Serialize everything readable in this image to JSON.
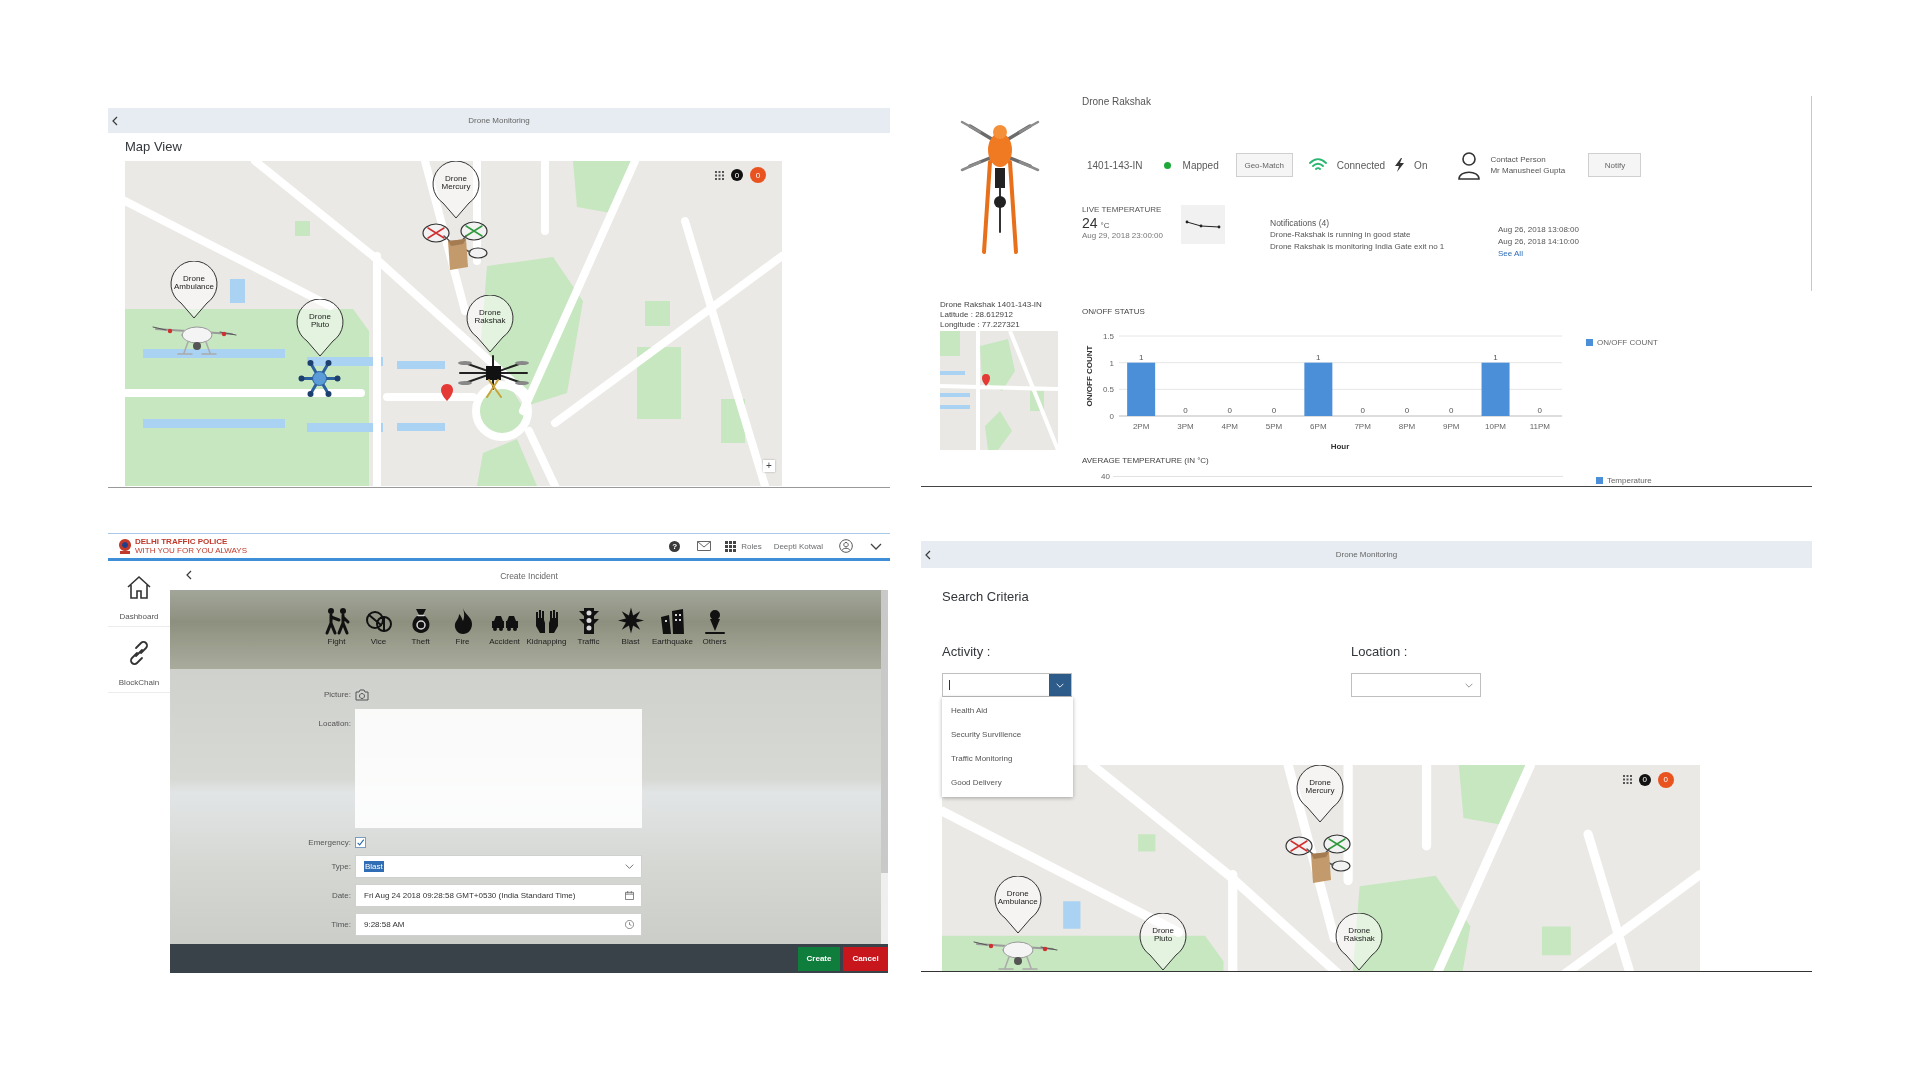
{
  "map_view": {
    "header": {
      "title": "Drone Monitoring"
    },
    "heading": "Map View",
    "map": {
      "markers": [
        {
          "label": "Drone Mercury",
          "kind": "cargo"
        },
        {
          "label": "Drone Ambulance",
          "kind": "medical"
        },
        {
          "label": "Drone Pluto",
          "kind": "hexacopter"
        },
        {
          "label": "Drone Rakshak",
          "kind": "octocopter"
        }
      ],
      "counters": [
        {
          "text": "0",
          "color": "#111111"
        },
        {
          "text": "0",
          "color": "#e8531f"
        }
      ],
      "zoom_button": "+"
    }
  },
  "drone_detail": {
    "title": "Drone Rakshak",
    "drone_id": "1401-143-IN",
    "mapping_status": "Mapped",
    "geo_match_button": "Geo-Match",
    "connection_status": "Connected",
    "power_status": "On",
    "contact": {
      "label": "Contact Person",
      "name": "Mr Manusheel Gupta"
    },
    "notify_button": "Notify",
    "live_temperature": {
      "label": "LIVE TEMPERATURE",
      "value": "24",
      "unit": "°C",
      "timestamp": "Aug 29, 2018 23:00:00"
    },
    "notifications": {
      "title": "Notifications (4)",
      "messages": [
        "Drone-Rakshak is running in good state",
        "Drone Rakshak is monitoring India Gate exit no 1"
      ],
      "times": [
        "Aug 26, 2018 13:08:00",
        "Aug 26, 2018 14:10:00"
      ],
      "link": "See All"
    },
    "location": {
      "name": "Drone Rakshak 1401-143-IN",
      "latitude": "Latitude : 28.612912",
      "longitude": "Longitude : 77.227321"
    },
    "status_chart": {
      "chart_data": {
        "type": "bar",
        "title": "ON/OFF STATUS",
        "xlabel": "Hour",
        "ylabel": "ON/OFF COUNT",
        "categories": [
          "2PM",
          "3PM",
          "4PM",
          "5PM",
          "6PM",
          "7PM",
          "8PM",
          "9PM",
          "10PM",
          "11PM"
        ],
        "series": [
          {
            "name": "ON/OFF COUNT",
            "color": "#4a8fd8",
            "values": [
              1,
              0,
              0,
              0,
              1,
              0,
              0,
              0,
              1,
              0
            ]
          }
        ],
        "ylim": [
          0,
          1.5
        ],
        "yticks": [
          0,
          0.5,
          1,
          1.5
        ],
        "data_labels": true
      }
    },
    "temperature_chart": {
      "title": "AVERAGE TEMPERATURE (IN °C)",
      "ytick": "40",
      "legend": "Temperature"
    }
  },
  "create_incident": {
    "top_bar": {
      "logo_title": "DELHI TRAFFIC POLICE",
      "logo_tagline": "WITH YOU FOR YOU ALWAYS",
      "help_button": "?",
      "roles": "Roles",
      "user": "Deepti Kotwal"
    },
    "sidebar": {
      "items": [
        {
          "label": "Dashboard"
        },
        {
          "label": "BlockChain"
        }
      ]
    },
    "title": "Create Incident",
    "incident_types": [
      {
        "label": "Fight"
      },
      {
        "label": "Vice"
      },
      {
        "label": "Theft"
      },
      {
        "label": "Fire"
      },
      {
        "label": "Accident"
      },
      {
        "label": "Kidnapping"
      },
      {
        "label": "Traffic"
      },
      {
        "label": "Blast"
      },
      {
        "label": "Earthquake"
      },
      {
        "label": "Others"
      }
    ],
    "form": {
      "picture": {
        "label": "Picture:"
      },
      "location": {
        "label": "Location:"
      },
      "emergency": {
        "label": "Emergency:",
        "checked": true
      },
      "type": {
        "label": "Type:",
        "value": "Blast",
        "text_selected": true
      },
      "date": {
        "label": "Date:",
        "value": "Fri Aug 24 2018 09:28:58 GMT+0530 (India Standard Time)"
      },
      "time": {
        "label": "Time:",
        "value": "9:28:58 AM"
      }
    },
    "buttons": [
      {
        "label": "Create",
        "kind": "accept"
      },
      {
        "label": "Cancel",
        "kind": "reject"
      }
    ]
  },
  "search": {
    "header": {
      "title": "Drone Monitoring"
    },
    "heading": "Search Criteria",
    "activity": {
      "label": "Activity :",
      "focused": true,
      "expanded": true,
      "options": [
        {
          "label": "Health Aid",
          "selected": false
        },
        {
          "label": "Security Survillence",
          "selected": false
        },
        {
          "label": "Traffic Monitoring",
          "selected": false
        },
        {
          "label": "Good Delivery",
          "selected": false
        }
      ]
    },
    "location": {
      "label": "Location :",
      "expanded": false
    },
    "map": {
      "markers": [
        {
          "label": "Drone Mercury",
          "kind": "cargo"
        },
        {
          "label": "Drone Ambulance",
          "kind": "medical"
        },
        {
          "label": "Drone Pluto"
        },
        {
          "label": "Drone Rakshak"
        }
      ],
      "counters": [
        {
          "text": "0",
          "color": "#111111"
        },
        {
          "text": "0",
          "color": "#e8531f"
        }
      ]
    }
  }
}
